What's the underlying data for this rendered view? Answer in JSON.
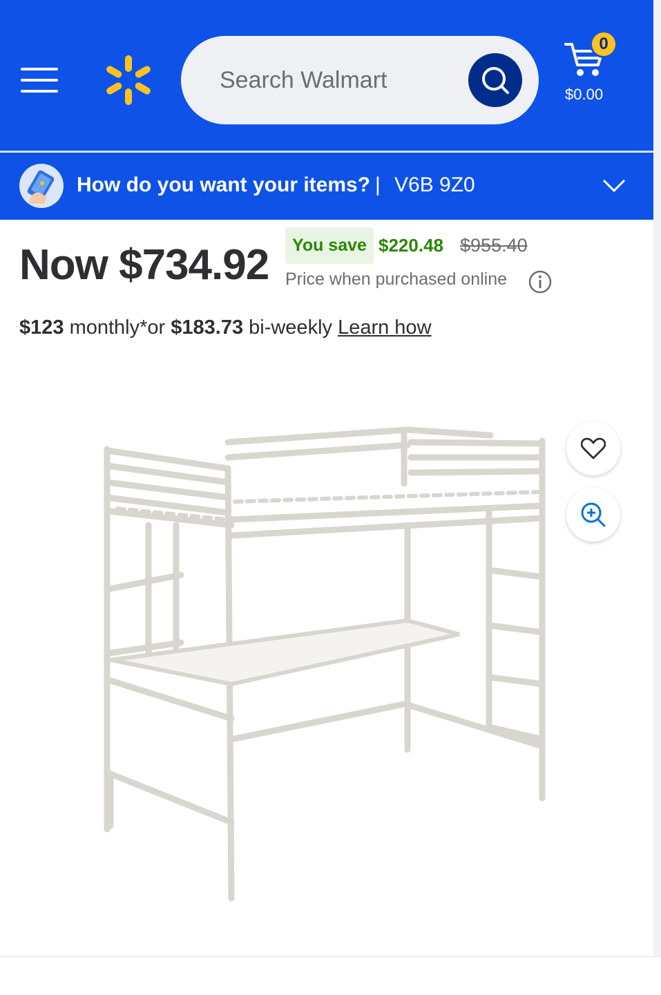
{
  "header": {
    "search_placeholder": "Search Walmart",
    "cart_count": "0",
    "cart_total": "$0.00",
    "colors": {
      "brand_blue": "#0f52e8",
      "spark_yellow": "#ffc220",
      "search_btn": "#002d8c"
    }
  },
  "delivery": {
    "question": "How do you want your items?",
    "separator": "|",
    "zip": "V6B 9Z0"
  },
  "price": {
    "now": "Now $734.92",
    "you_save_label": "You save",
    "save_amount": "$220.48",
    "was": "$955.40",
    "note": "Price when purchased online"
  },
  "financing": {
    "monthly_amount": "$123",
    "monthly_text": " monthly*or ",
    "biweekly_amount": "$183.73",
    "biweekly_text": " bi-weekly ",
    "learn_how": "Learn how"
  },
  "icons": {
    "menu": "menu-icon",
    "logo": "walmart-spark-icon",
    "search": "search-icon",
    "cart": "cart-icon",
    "delivery": "delivery-phone-icon",
    "chevron": "chevron-down-icon",
    "info": "info-icon",
    "favorite": "heart-icon",
    "zoom": "zoom-in-icon"
  }
}
